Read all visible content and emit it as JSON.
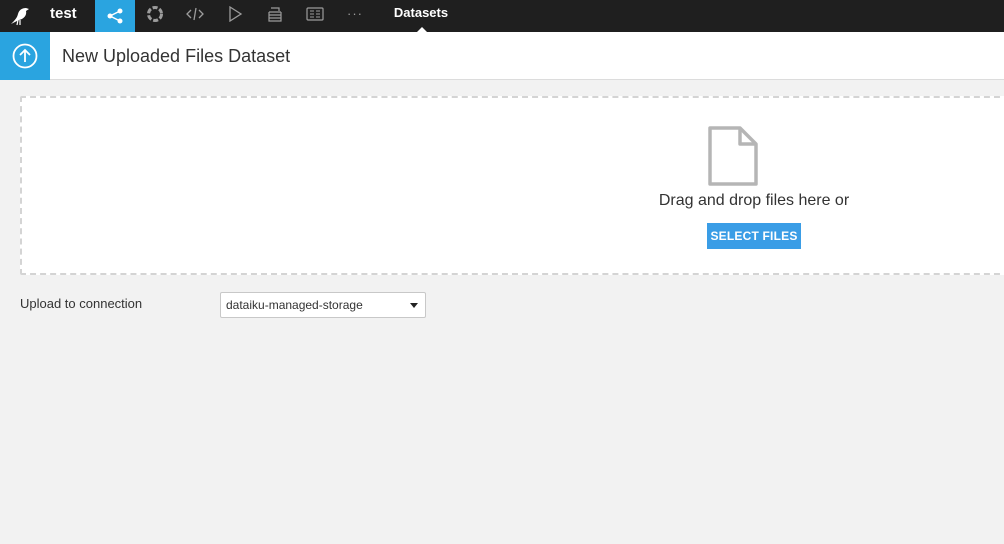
{
  "nav": {
    "project_name": "test",
    "icons": [
      "flow-icon",
      "lab-icon",
      "code-icon",
      "run-icon",
      "deploy-icon",
      "wiki-icon",
      "more-icon"
    ],
    "more_label": "···",
    "active_tab": "Datasets"
  },
  "header": {
    "title": "New Uploaded Files Dataset"
  },
  "dropzone": {
    "text": "Drag and drop files here or",
    "button_label": "SELECT FILES"
  },
  "connection": {
    "label": "Upload to connection",
    "selected": "dataiku-managed-storage"
  },
  "colors": {
    "accent": "#2aa4e0",
    "button": "#3a9de6",
    "nav_bg": "#1f1f1f"
  }
}
